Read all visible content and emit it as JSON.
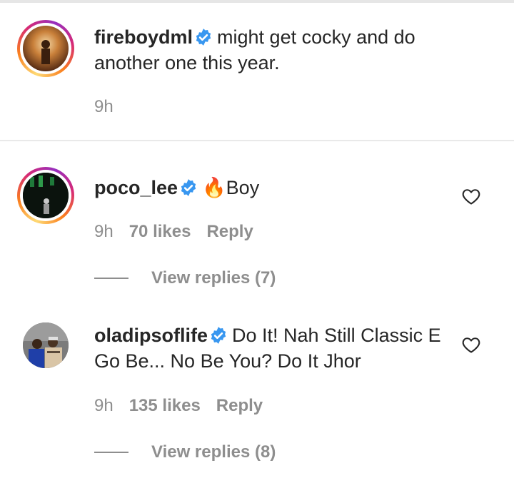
{
  "caption": {
    "username": "fireboydml",
    "text": "might get cocky and do another one this year.",
    "time": "9h"
  },
  "comments": [
    {
      "username": "poco_lee",
      "emoji": "🔥",
      "text": "Boy",
      "time": "9h",
      "likes": "70 likes",
      "reply_label": "Reply",
      "view_replies": "View replies (7)"
    },
    {
      "username": "oladipsoflife",
      "text": "Do It! Nah Still Classic E Go Be... No Be You? Do It Jhor",
      "time": "9h",
      "likes": "135 likes",
      "reply_label": "Reply",
      "view_replies": "View replies (8)"
    }
  ],
  "icons": {
    "verified": "verified-badge-icon",
    "like": "heart-outline-icon"
  },
  "colors": {
    "verified": "#3897f0",
    "text": "#262626",
    "secondary": "#8e8e8e"
  }
}
